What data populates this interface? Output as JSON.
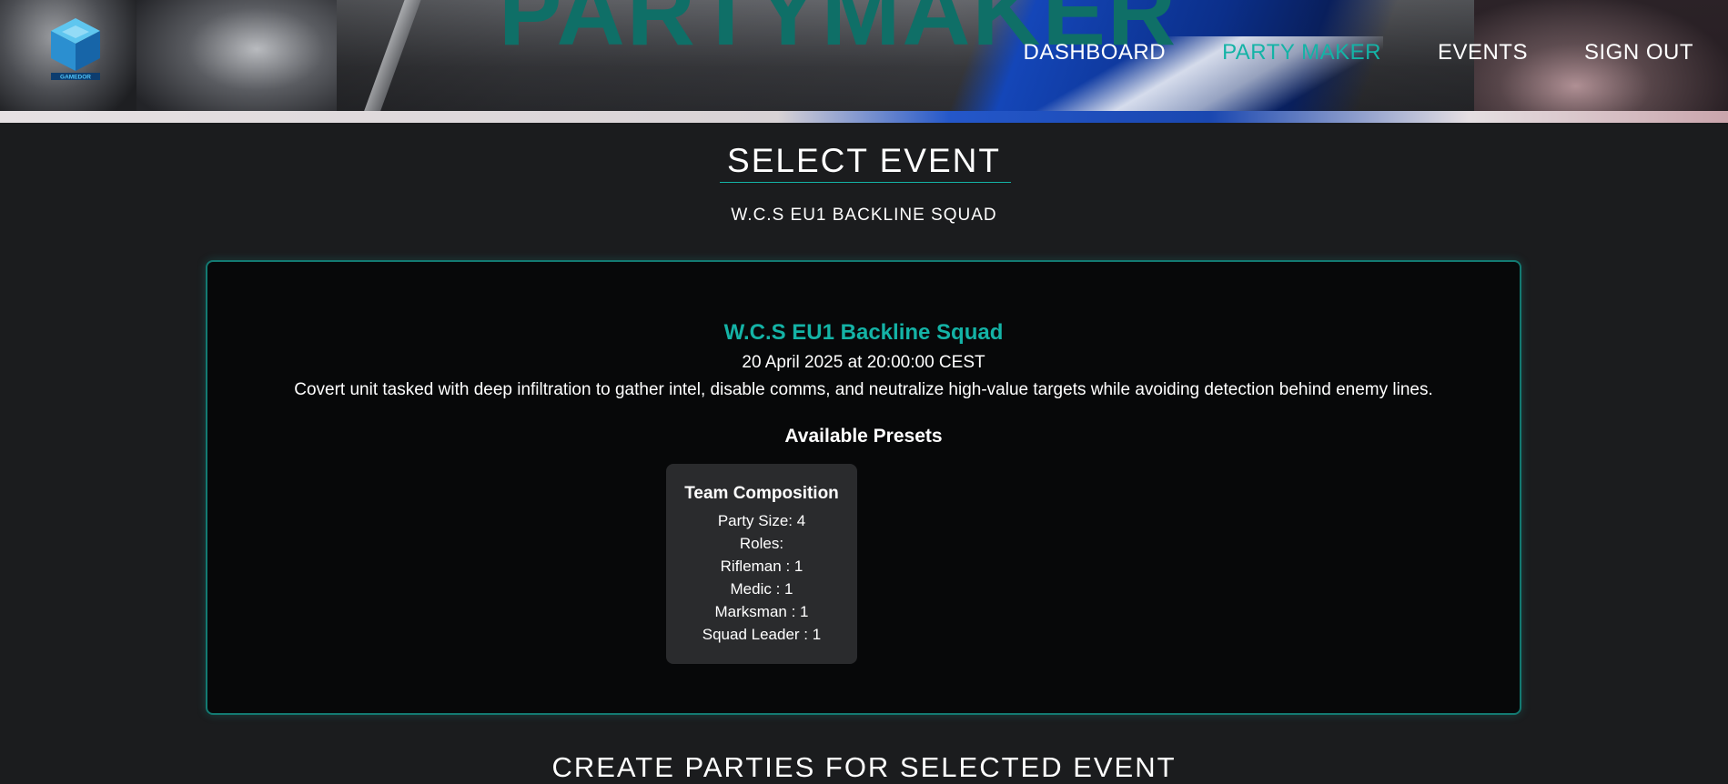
{
  "header": {
    "banner_title": "PARTYMAKER",
    "logo_text": "GAMEDOR",
    "nav": [
      {
        "label": "DASHBOARD",
        "active": false
      },
      {
        "label": "PARTY MAKER",
        "active": true
      },
      {
        "label": "EVENTS",
        "active": false
      },
      {
        "label": "SIGN OUT",
        "active": false
      }
    ]
  },
  "select_event": {
    "title": "SELECT EVENT",
    "selected_name": "W.C.S EU1 BACKLINE SQUAD"
  },
  "event": {
    "name": "W.C.S EU1 Backline Squad",
    "date": "20 April 2025 at 20:00:00 CEST",
    "description": "Covert unit tasked with deep infiltration to gather intel, disable comms, and neutralize high-value targets while avoiding detection behind enemy lines.",
    "presets_heading": "Available Presets",
    "presets": [
      {
        "title": "Team Composition",
        "party_size": "Party Size: 4",
        "roles_label": "Roles:",
        "roles": [
          "Rifleman : 1",
          "Medic : 1",
          "Marksman : 1",
          "Squad Leader : 1"
        ]
      }
    ]
  },
  "create_parties": {
    "title": "CREATE PARTIES FOR SELECTED EVENT"
  },
  "colors": {
    "accent": "#14b3a6",
    "background": "#1b1c1e",
    "card": "#070809",
    "preset_card": "#2a2b2d",
    "banner_title": "#0f6f67"
  }
}
